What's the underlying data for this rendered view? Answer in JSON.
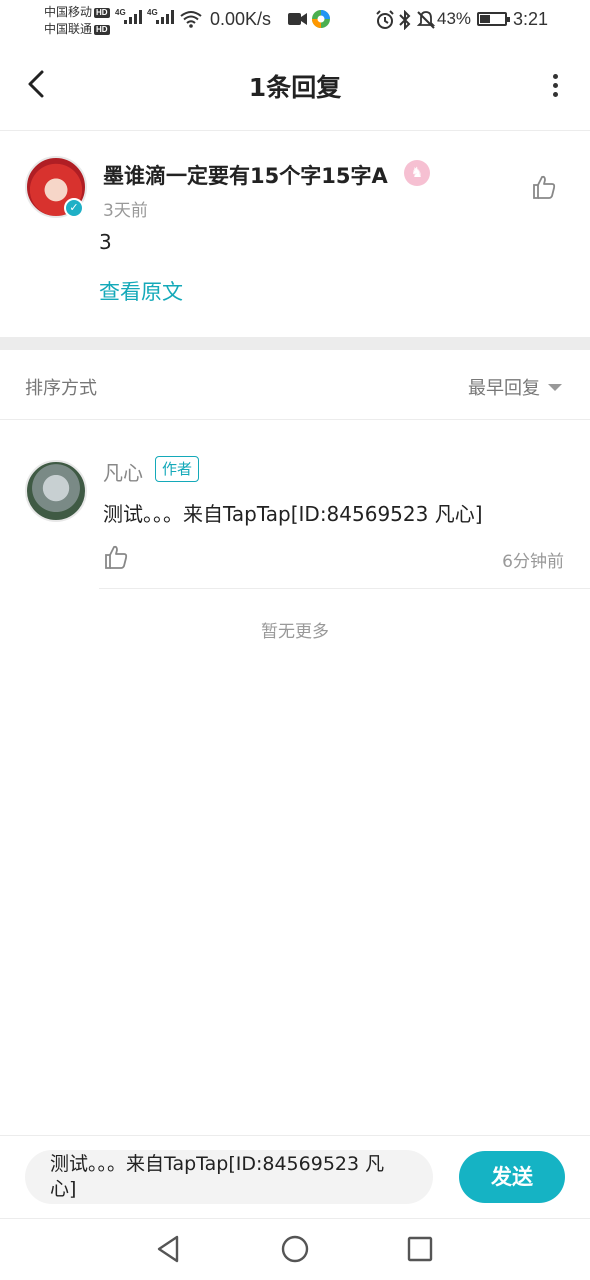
{
  "status_bar": {
    "carrier1": "中国移动",
    "carrier2": "中国联通",
    "hd": "HD",
    "net_type": "4G",
    "speed": "0.00K/s",
    "battery": "43%",
    "battery_level": 0.43,
    "time": "3:21"
  },
  "header": {
    "title": "1条回复"
  },
  "original": {
    "username": "墨谁滴一定要有15个字15字A",
    "time": "3天前",
    "content": "3",
    "view_original": "查看原文"
  },
  "sort": {
    "label": "排序方式",
    "selected": "最早回复"
  },
  "reply": {
    "username": "凡心",
    "author_tag": "作者",
    "content": "测试。。。来自TapTap[ID:84569523 凡心]",
    "time": "6分钟前"
  },
  "footer_note": "暂无更多",
  "input": {
    "value": "测试。。。来自TapTap[ID:84569523 凡心]",
    "send_label": "发送"
  },
  "colors": {
    "accent": "#15b3c4",
    "link": "#14a9b9",
    "muted": "#999999"
  },
  "icons": [
    "back-arrow-icon",
    "more-vertical-icon",
    "thumbs-up-icon",
    "verified-icon",
    "dropdown-triangle-icon",
    "nav-back-icon",
    "nav-home-icon",
    "nav-recents-icon"
  ]
}
